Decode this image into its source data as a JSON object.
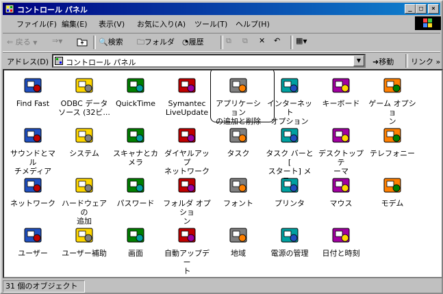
{
  "window": {
    "title": "コントロール パネル",
    "controls": [
      "_",
      "□",
      "×"
    ]
  },
  "menubar": [
    "ファイル(F)",
    "編集(E)",
    "表示(V)",
    "お気に入り(A)",
    "ツール(T)",
    "ヘルプ(H)"
  ],
  "toolbar": {
    "back": "戻る",
    "search": "検索",
    "folders": "フォルダ",
    "history": "履歴"
  },
  "address": {
    "label": "アドレス(D)",
    "value": "コントロール パネル",
    "go": "移動",
    "links": "リンク"
  },
  "items": [
    {
      "label": "Find Fast",
      "icon": "find-fast-binoculars-icon"
    },
    {
      "label": "ODBC データ\nソース (32ビ...",
      "icon": "odbc-icon"
    },
    {
      "label": "QuickTime",
      "icon": "quicktime-icon"
    },
    {
      "label": "Symantec\nLiveUpdate",
      "icon": "liveupdate-globe-icon"
    },
    {
      "label": "アプリケーション\nの追加と削除",
      "icon": "add-remove-programs-icon"
    },
    {
      "label": "インターネット\nオプション",
      "icon": "internet-options-icon"
    },
    {
      "label": "キーボード",
      "icon": "keyboard-icon"
    },
    {
      "label": "ゲーム オプショ\nン",
      "icon": "game-controller-icon"
    },
    {
      "label": "サウンドとマル\nチメディア",
      "icon": "speaker-icon"
    },
    {
      "label": "システム",
      "icon": "computer-icon"
    },
    {
      "label": "スキャナとカメラ",
      "icon": "scanner-camera-icon"
    },
    {
      "label": "ダイヤルアップ\nネットワーク",
      "icon": "dialup-network-folder-icon"
    },
    {
      "label": "タスク",
      "icon": "scheduled-tasks-folder-icon"
    },
    {
      "label": "タスク バーと [\nスタート] メニ...",
      "icon": "taskbar-icon"
    },
    {
      "label": "デスクトップ テ\nーマ",
      "icon": "desktop-themes-icon"
    },
    {
      "label": "テレフォニー",
      "icon": "telephony-icon"
    },
    {
      "label": "ネットワーク",
      "icon": "network-icon"
    },
    {
      "label": "ハードウェアの\n追加",
      "icon": "add-hardware-icon"
    },
    {
      "label": "パスワード",
      "icon": "keys-icon"
    },
    {
      "label": "フォルダ オプショ\nン",
      "icon": "folder-options-icon"
    },
    {
      "label": "フォント",
      "icon": "fonts-folder-icon"
    },
    {
      "label": "プリンタ",
      "icon": "printers-folder-icon"
    },
    {
      "label": "マウス",
      "icon": "mouse-icon"
    },
    {
      "label": "モデム",
      "icon": "modem-phone-icon"
    },
    {
      "label": "ユーザー",
      "icon": "users-icon"
    },
    {
      "label": "ユーザー補助",
      "icon": "accessibility-icon"
    },
    {
      "label": "画面",
      "icon": "display-icon"
    },
    {
      "label": "自動アップデー\nト",
      "icon": "automatic-updates-icon"
    },
    {
      "label": "地域",
      "icon": "regional-globe-icon"
    },
    {
      "label": "電源の管理",
      "icon": "power-management-icon"
    },
    {
      "label": "日付と時刻",
      "icon": "date-time-icon"
    }
  ],
  "status": "31 個のオブジェクト"
}
